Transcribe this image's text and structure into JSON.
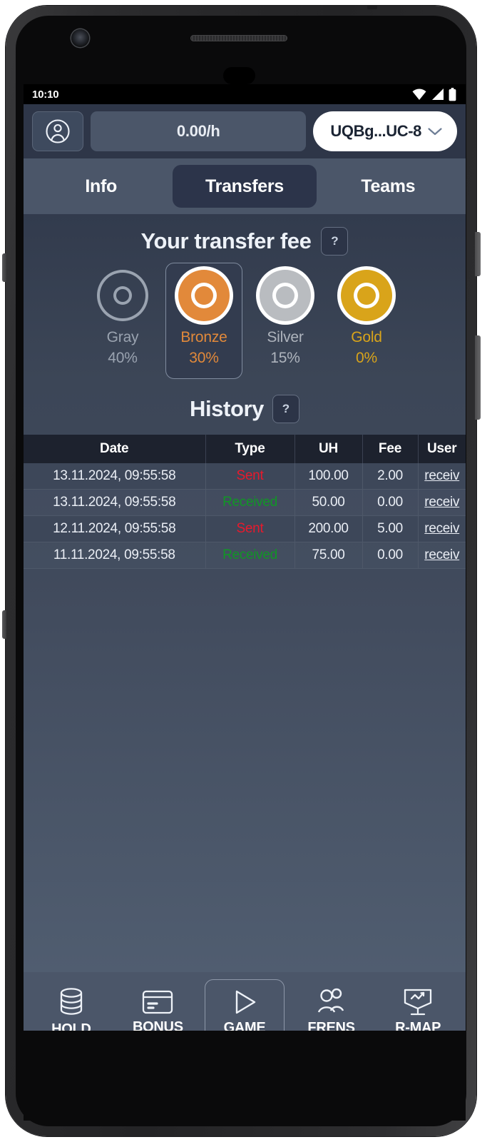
{
  "status_bar": {
    "time": "10:10",
    "icons": [
      "wifi-icon",
      "cellular-signal-icon",
      "battery-icon"
    ]
  },
  "top_bar": {
    "avatar_icon": "user-circle-icon",
    "rate_value": "0.00/h",
    "wallet_address": "UQBg...UC-8",
    "wallet_chevron_icon": "chevron-down-icon"
  },
  "tabs": [
    {
      "label": "Info",
      "active": false
    },
    {
      "label": "Transfers",
      "active": true
    },
    {
      "label": "Teams",
      "active": false
    }
  ],
  "transfer_fee": {
    "title": "Your transfer fee",
    "help_label": "?",
    "tiers": [
      {
        "name": "Gray",
        "percent": "40%",
        "color": "#9aa3b0",
        "fill": "transparent",
        "selected": false
      },
      {
        "name": "Bronze",
        "percent": "30%",
        "color": "#e2893a",
        "fill": "#e2893a",
        "selected": true
      },
      {
        "name": "Silver",
        "percent": "15%",
        "color": "#b9bcc0",
        "fill": "#b9bcc0",
        "selected": false
      },
      {
        "name": "Gold",
        "percent": "0%",
        "color": "#d9a41a",
        "fill": "#d9a41a",
        "selected": false
      }
    ]
  },
  "history": {
    "title": "History",
    "help_label": "?",
    "columns": [
      "Date",
      "Type",
      "UH",
      "Fee",
      "User"
    ],
    "rows": [
      {
        "date": "13.11.2024, 09:55:58",
        "type": "Sent",
        "type_kind": "sent",
        "uh": "100.00",
        "fee": "2.00",
        "user": "receiv"
      },
      {
        "date": "13.11.2024, 09:55:58",
        "type": "Received",
        "type_kind": "received",
        "uh": "50.00",
        "fee": "0.00",
        "user": "receiv"
      },
      {
        "date": "12.11.2024, 09:55:58",
        "type": "Sent",
        "type_kind": "sent",
        "uh": "200.00",
        "fee": "5.00",
        "user": "receiv"
      },
      {
        "date": "11.11.2024, 09:55:58",
        "type": "Received",
        "type_kind": "received",
        "uh": "75.00",
        "fee": "0.00",
        "user": "receiv"
      }
    ]
  },
  "bottom_nav": [
    {
      "label": "HOLD",
      "icon": "coin-stack-icon",
      "active": false
    },
    {
      "label": "BONUS",
      "icon": "credit-card-icon",
      "active": false
    },
    {
      "label": "GAME",
      "icon": "play-icon",
      "active": true
    },
    {
      "label": "FRENS",
      "icon": "people-icon",
      "active": false
    },
    {
      "label": "R-MAP",
      "icon": "chart-board-icon",
      "active": false
    }
  ],
  "colors": {
    "sent": "#e8192c",
    "received": "#119626",
    "accent_bronze": "#e2893a",
    "accent_gold": "#d9a41a",
    "panel": "#4b5669",
    "tab_active": "#2c344a"
  }
}
